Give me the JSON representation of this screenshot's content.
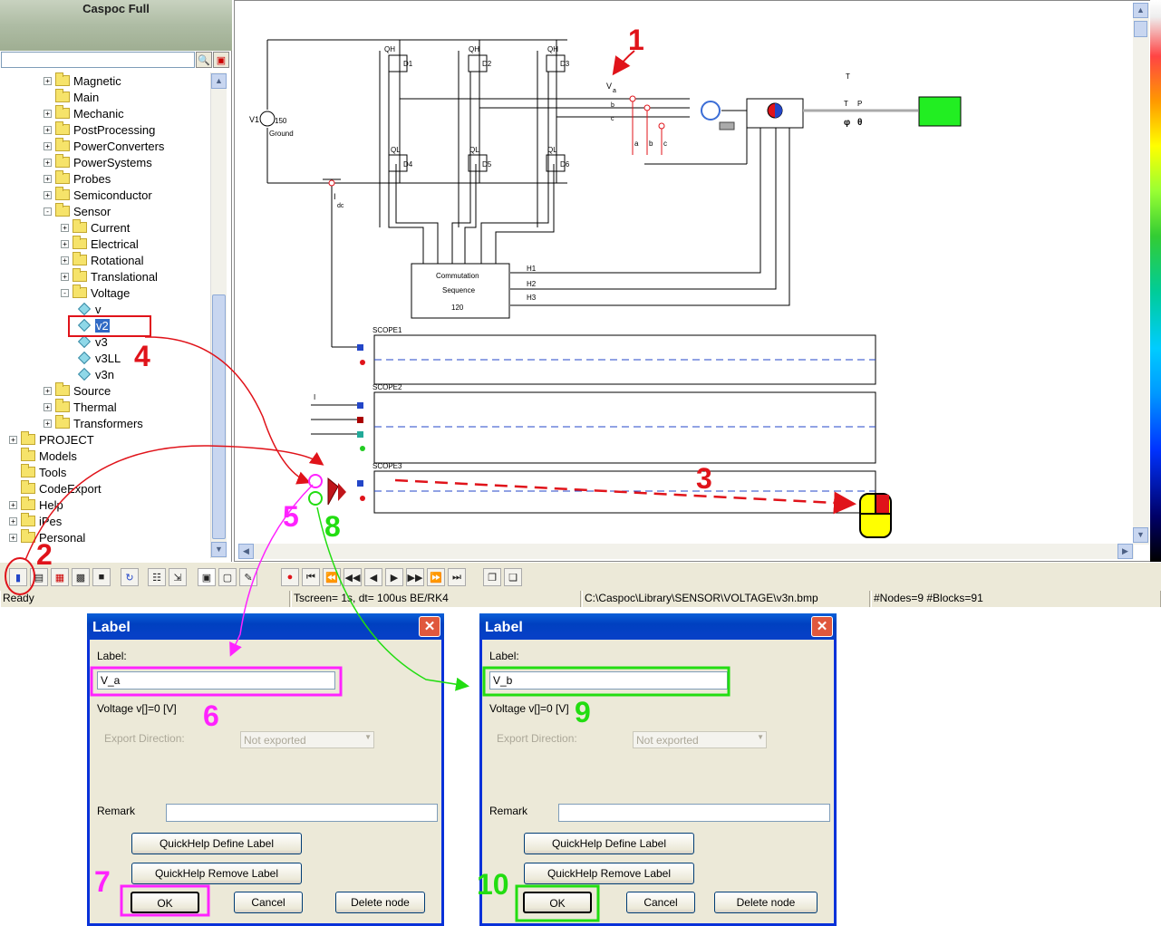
{
  "app": {
    "title": "Caspoc Full"
  },
  "tree": {
    "items": [
      {
        "label": "Magnetic",
        "level": 2,
        "exp": "+"
      },
      {
        "label": "Main",
        "level": 2,
        "exp": ""
      },
      {
        "label": "Mechanic",
        "level": 2,
        "exp": "+"
      },
      {
        "label": "PostProcessing",
        "level": 2,
        "exp": "+"
      },
      {
        "label": "PowerConverters",
        "level": 2,
        "exp": "+"
      },
      {
        "label": "PowerSystems",
        "level": 2,
        "exp": "+"
      },
      {
        "label": "Probes",
        "level": 2,
        "exp": "+"
      },
      {
        "label": "Semiconductor",
        "level": 2,
        "exp": "+"
      },
      {
        "label": "Sensor",
        "level": 2,
        "exp": "-"
      },
      {
        "label": "Current",
        "level": 3,
        "exp": "+"
      },
      {
        "label": "Electrical",
        "level": 3,
        "exp": "+"
      },
      {
        "label": "Rotational",
        "level": 3,
        "exp": "+"
      },
      {
        "label": "Translational",
        "level": 3,
        "exp": "+"
      },
      {
        "label": "Voltage",
        "level": 3,
        "exp": "-"
      },
      {
        "label": "v",
        "level": 4,
        "leaf": true
      },
      {
        "label": "v2",
        "level": 4,
        "leaf": true,
        "selected": true
      },
      {
        "label": "v3",
        "level": 4,
        "leaf": true
      },
      {
        "label": "v3LL",
        "level": 4,
        "leaf": true
      },
      {
        "label": "v3n",
        "level": 4,
        "leaf": true
      },
      {
        "label": "Source",
        "level": 2,
        "exp": "+"
      },
      {
        "label": "Thermal",
        "level": 2,
        "exp": "+"
      },
      {
        "label": "Transformers",
        "level": 2,
        "exp": "+"
      },
      {
        "label": "PROJECT",
        "level": 0,
        "exp": "+"
      },
      {
        "label": "Models",
        "level": 0,
        "exp": ""
      },
      {
        "label": "Tools",
        "level": 0,
        "exp": ""
      },
      {
        "label": "CodeExport",
        "level": 0,
        "exp": ""
      },
      {
        "label": "Help",
        "level": 0,
        "exp": "+"
      },
      {
        "label": "iPes",
        "level": 0,
        "exp": "+"
      },
      {
        "label": "Personal",
        "level": 0,
        "exp": "+"
      }
    ]
  },
  "schematic": {
    "source_label": "V1",
    "source_value": "150",
    "ground_label": "Ground",
    "qh": "QH",
    "ql": "QL",
    "diodes": [
      "D1",
      "D2",
      "D3",
      "D4",
      "D5",
      "D6"
    ],
    "idc_main": "I",
    "idc_sub": "dc",
    "phase_main": "V",
    "phase_v": [
      "a",
      "b",
      "c"
    ],
    "phase_i": [
      "a",
      "b",
      "c"
    ],
    "commutation": [
      "Commutation",
      "Sequence",
      "120"
    ],
    "hall": [
      "H1",
      "H2",
      "H3"
    ],
    "scopes": [
      "SCOPE1",
      "SCOPE2",
      "SCOPE3"
    ],
    "tp": [
      "T",
      "T",
      "P"
    ]
  },
  "statusbar": {
    "ready": "Ready",
    "sim": "Tscreen= 1s, dt= 100us BE/RK4",
    "path": "C:\\Caspoc\\Library\\SENSOR\\VOLTAGE\\v3n.bmp",
    "info": "#Nodes=9 #Blocks=91"
  },
  "dialogs": [
    {
      "title": "Label",
      "label_caption": "Label:",
      "label_value": "V_a",
      "voltage_text": "Voltage v[]=0 [V]",
      "export_caption": "Export Direction:",
      "export_value": "Not exported",
      "remark_caption": "Remark",
      "remark_value": "",
      "quickhelp_define": "QuickHelp Define Label",
      "quickhelp_remove": "QuickHelp Remove Label",
      "ok": "OK",
      "cancel": "Cancel",
      "delete": "Delete node"
    },
    {
      "title": "Label",
      "label_caption": "Label:",
      "label_value": "V_b",
      "voltage_text": "Voltage v[]=0 [V]",
      "export_caption": "Export Direction:",
      "export_value": "Not exported",
      "remark_caption": "Remark",
      "remark_value": "",
      "quickhelp_define": "QuickHelp Define Label",
      "quickhelp_remove": "QuickHelp Remove Label",
      "ok": "OK",
      "cancel": "Cancel",
      "delete": "Delete node"
    }
  ],
  "annotations": {
    "n1": "1",
    "n2": "2",
    "n3": "3",
    "n4": "4",
    "n5": "5",
    "n6": "6",
    "n7": "7",
    "n8": "8",
    "n9": "9",
    "n10": "10"
  },
  "colors": {
    "red": "#e0131a",
    "magenta": "#ff22ff",
    "green": "#22dd11",
    "title_blue": "#0040c0"
  }
}
